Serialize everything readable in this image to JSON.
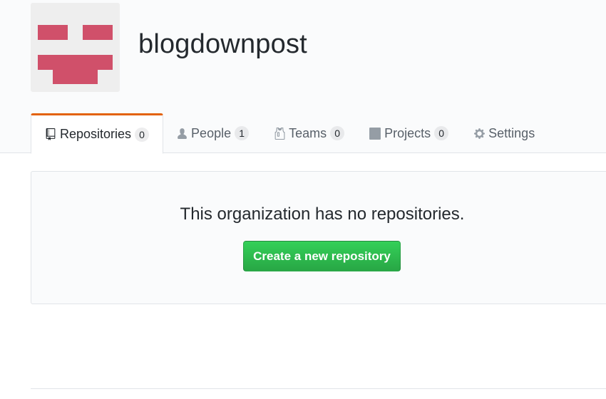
{
  "org": {
    "name": "blogdownpost",
    "avatar_color": "#d0506a"
  },
  "tabs": [
    {
      "label": "Repositories",
      "count": "0",
      "icon": "repo-icon",
      "selected": true
    },
    {
      "label": "People",
      "count": "1",
      "icon": "person-icon"
    },
    {
      "label": "Teams",
      "count": "0",
      "icon": "jersey-icon"
    },
    {
      "label": "Projects",
      "count": "0",
      "icon": "project-icon"
    },
    {
      "label": "Settings",
      "icon": "gear-icon"
    }
  ],
  "blankslate": {
    "message": "This organization has no repositories.",
    "button_label": "Create a new repository"
  },
  "colors": {
    "accent_tab": "#e36209",
    "button_green": "#28a745"
  }
}
